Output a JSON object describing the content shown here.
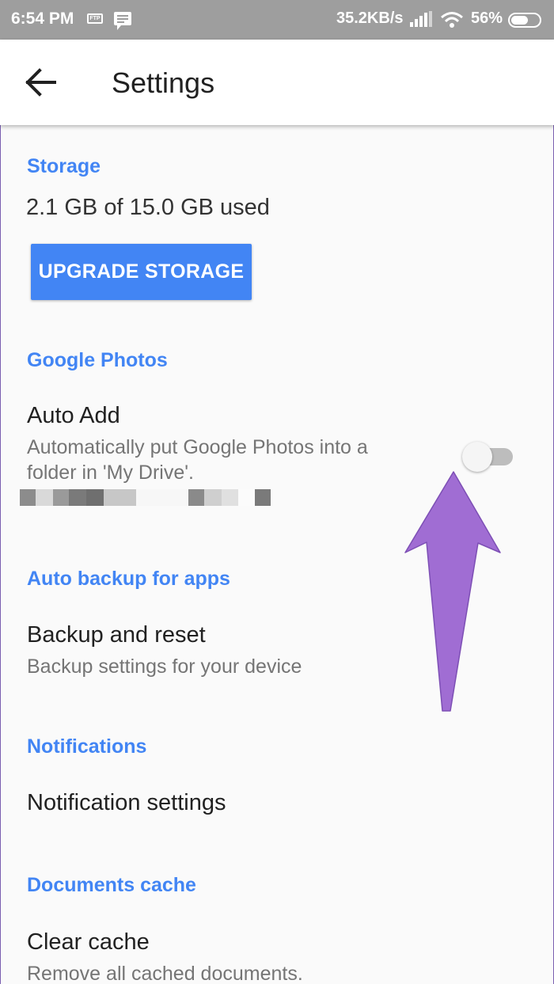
{
  "status_bar": {
    "time": "6:54 PM",
    "ftp_badge": "FTP",
    "network_speed": "35.2KB/s",
    "battery_percent": "56%",
    "icons": [
      "ftp-icon",
      "message-icon",
      "signal-icon",
      "wifi-icon",
      "battery-icon"
    ]
  },
  "app_bar": {
    "back_icon": "arrow-back-icon",
    "title": "Settings"
  },
  "sections": {
    "storage": {
      "header": "Storage",
      "used_text": "2.1 GB of 15.0 GB used",
      "upgrade_label": "UPGRADE STORAGE"
    },
    "google_photos": {
      "header": "Google Photos",
      "auto_add_title": "Auto Add",
      "auto_add_sub_line1": "Automatically put Google Photos into a",
      "auto_add_sub_line2": "folder in 'My Drive'.",
      "auto_add_enabled": false
    },
    "auto_backup": {
      "header": "Auto backup for apps",
      "backup_title": "Backup and reset",
      "backup_sub": "Backup settings for your device"
    },
    "notifications": {
      "header": "Notifications",
      "settings_title": "Notification settings"
    },
    "documents_cache": {
      "header": "Documents cache",
      "clear_title": "Clear cache",
      "clear_sub": "Remove all cached documents."
    }
  },
  "colors": {
    "accent": "#4285f4",
    "status_bar": "#9e9e9e",
    "annotation_arrow": "#a06dd3"
  }
}
